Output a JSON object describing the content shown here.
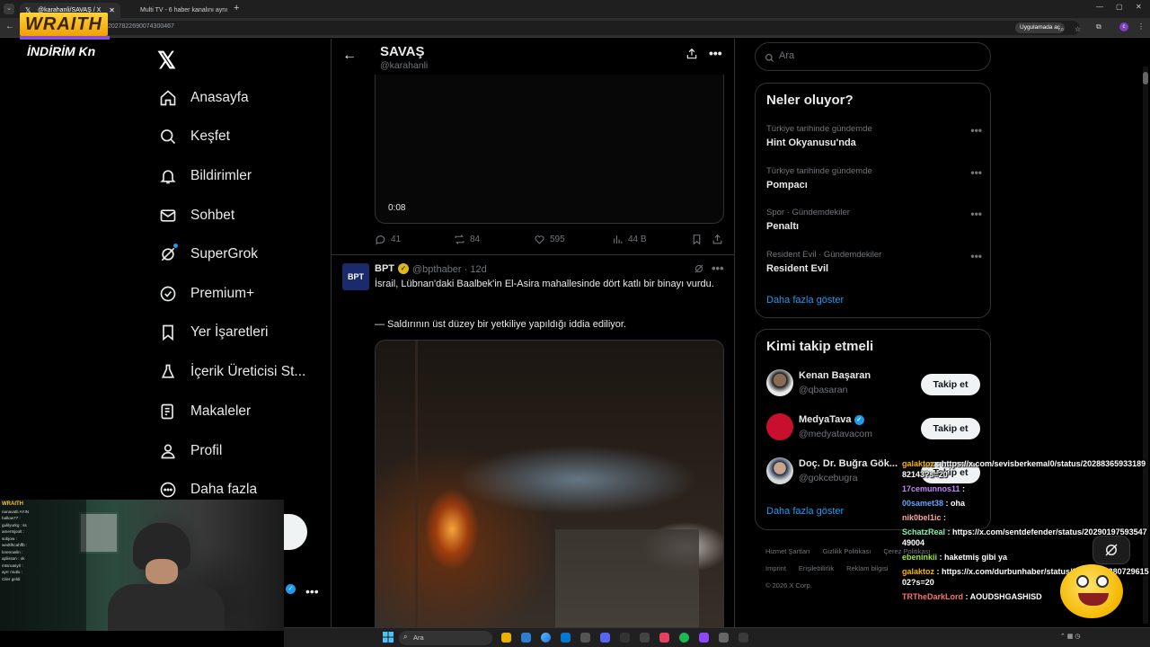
{
  "browser": {
    "tabs": [
      {
        "title": "@karahanli/SAVAŞ / X",
        "favicon": "𝕏"
      },
      {
        "title": "Multi TV - 6 haber kanalını aynı"
      }
    ],
    "url": "/2027822690074300467",
    "open_app_label": "Uygulamada aç"
  },
  "overlay": {
    "streamer_logo": "WRAITH",
    "indirim": "İNDİRİM Kn"
  },
  "nav": {
    "logo": "𝕏",
    "items": [
      {
        "label": "Anasayfa",
        "icon": "home-icon"
      },
      {
        "label": "Keşfet",
        "icon": "search-icon"
      },
      {
        "label": "Bildirimler",
        "icon": "bell-icon"
      },
      {
        "label": "Sohbet",
        "icon": "mail-icon"
      },
      {
        "label": "SuperGrok",
        "icon": "grok-icon"
      },
      {
        "label": "Premium+",
        "icon": "verified-icon"
      },
      {
        "label": "Yer İşaretleri",
        "icon": "bookmark-icon"
      },
      {
        "label": "İçerik Üreticisi St...",
        "icon": "creator-icon"
      },
      {
        "label": "Makaleler",
        "icon": "article-icon"
      },
      {
        "label": "Profil",
        "icon": "person-icon"
      },
      {
        "label": "Daha fazla",
        "icon": "more-circle-icon"
      }
    ]
  },
  "header": {
    "title": "SAVAŞ",
    "handle": "@karahanli"
  },
  "tweet1": {
    "video_time": "0:08",
    "replies": "41",
    "reposts": "84",
    "likes": "595",
    "views": "44 B"
  },
  "tweet2": {
    "avatar_text": "BPT",
    "name": "BPT",
    "handle": "@bpthaber",
    "time": "12d",
    "text1": "İsrail, Lübnan'daki Baalbek'in El-Asira mahallesinde dört katlı bir binayı vurdu.",
    "text2": "— Saldırının üst düzey bir yetkiliye yapıldığı iddia ediliyor."
  },
  "search": {
    "placeholder": "Ara"
  },
  "trends": {
    "title": "Neler oluyor?",
    "items": [
      {
        "context": "Türkiye tarihinde gündemde",
        "title": "Hint Okyanusu'nda"
      },
      {
        "context": "Türkiye tarihinde gündemde",
        "title": "Pompacı"
      },
      {
        "context": "Spor · Gündemdekiler",
        "title": "Penaltı"
      },
      {
        "context": "Resident Evil · Gündemdekiler",
        "title": "Resident Evil"
      }
    ],
    "show_more": "Daha fazla göster"
  },
  "follow": {
    "title": "Kimi takip etmeli",
    "items": [
      {
        "name": "Kenan Başaran",
        "handle": "@qbasaran",
        "button": "Takip et",
        "avatar_color": "#e8e8e8"
      },
      {
        "name": "MedyaTava",
        "handle": "@medyatavacom",
        "button": "Takip et",
        "avatar_color": "#c8102e"
      },
      {
        "name": "Doç. Dr. Buğra Gök...",
        "handle": "@gokcebugra",
        "button": "Takip et",
        "avatar_color": "#d9d9d9"
      }
    ],
    "show_more": "Daha fazla göster"
  },
  "footer": {
    "links": [
      "Hizmet Şartları",
      "Gizlilik Politikası",
      "Çerez Politikası",
      "Imprint",
      "Erişilebilirlik",
      "Reklam bilgisi"
    ],
    "copyright": "© 2026 X Corp."
  },
  "chat": [
    {
      "user": "galaktoz",
      "color": "#f5b400",
      "msg": " : https://x.com/sevisberkemal0/status/2028836593318982143?s=20"
    },
    {
      "user": "17cemunnos11",
      "color": "#c084fc",
      "msg": " : "
    },
    {
      "user": "00samet38",
      "color": "#60a5fa",
      "msg": " : oha"
    },
    {
      "user": "nik0bel1ic",
      "color": "#fca5a5",
      "msg": " : "
    },
    {
      "user": "SchatzReal",
      "color": "#86efac",
      "msg": " : https://x.com/sentdefender/status/2029019759354749004"
    },
    {
      "user": "ebeninkii",
      "color": "#a3e635",
      "msg": " : haketmiş gibi ya"
    },
    {
      "user": "galaktoz",
      "color": "#f5b400",
      "msg": " : https://x.com/durbunhaber/status/2028757938072961502?s=20"
    },
    {
      "user": "TRTheDarkLord",
      "color": "#f87171",
      "msg": " : AOUDSHGASHISD"
    }
  ],
  "webcam_chat": {
    "header": "WRAITH",
    "lines": [
      "nanavatlı AYIN",
      "hallow77 :",
      "gulilyurkg : ss",
      "amertsjoolt :",
      "sobjow :",
      "wedtlhcahffb :",
      "lorenowlin :",
      "aplisson : ok",
      "mtsroasyrl :",
      "ayrr mutlu :",
      "Ciler geldi"
    ]
  },
  "taskbar": {
    "search_placeholder": "Ara"
  }
}
